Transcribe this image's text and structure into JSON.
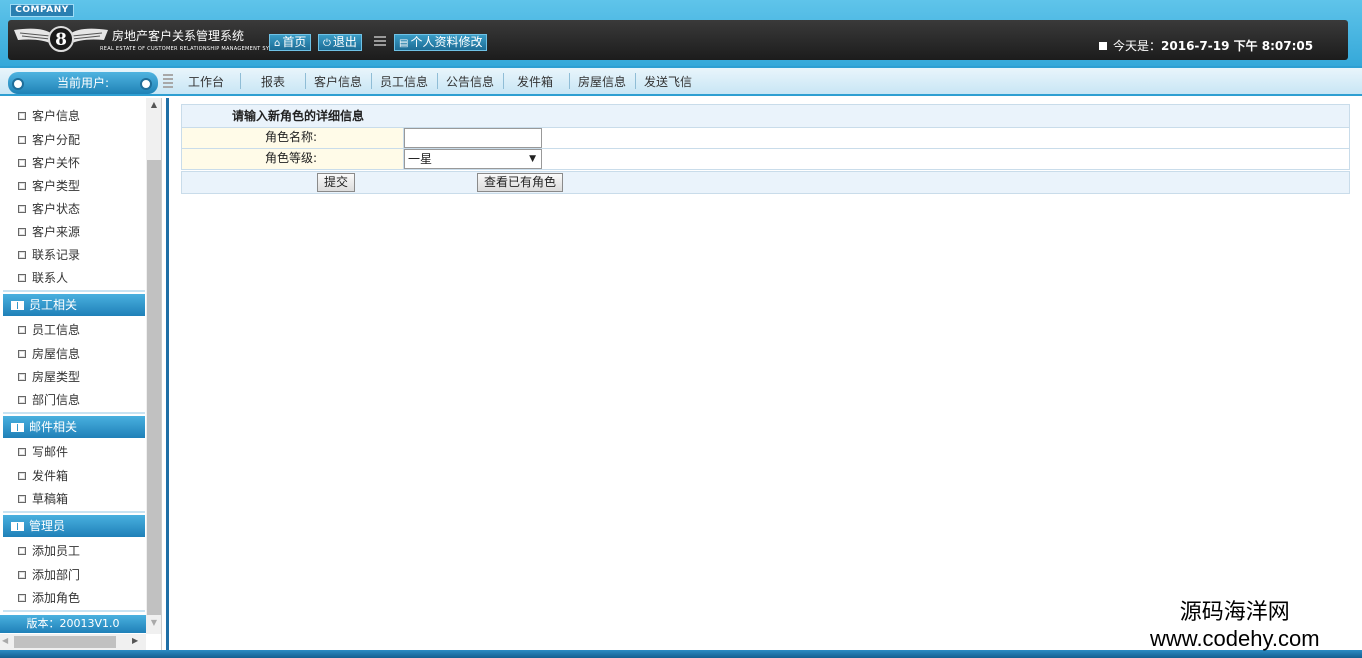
{
  "header": {
    "company_tag": "COMPANY",
    "system_title": "房地产客户关系管理系统",
    "system_subtitle": "REAL ESTATE OF CUSTOMER RELATIONSHIP MANAGEMENT SYSTEM",
    "buttons": {
      "home": "首页",
      "exit": "退出",
      "profile": "个人资料修改"
    },
    "today_label": "今天是：",
    "today_value": "2016-7-19 下午 8:07:05"
  },
  "navbar": {
    "current_user": "当前用户:",
    "items": [
      "工作台",
      "报表",
      "客户信息",
      "员工信息",
      "公告信息",
      "发件箱",
      "房屋信息",
      "发送飞信"
    ]
  },
  "sidebar": {
    "customer_items": [
      "客户信息",
      "客户分配",
      "客户关怀",
      "客户类型",
      "客户状态",
      "客户来源",
      "联系记录",
      "联系人"
    ],
    "employee_section": {
      "title": "员工相关",
      "items": [
        "员工信息",
        "房屋信息",
        "房屋类型",
        "部门信息"
      ]
    },
    "mail_section": {
      "title": "邮件相关",
      "items": [
        "写邮件",
        "发件箱",
        "草稿箱"
      ]
    },
    "admin_section": {
      "title": "管理员",
      "items": [
        "添加员工",
        "添加部门",
        "添加角色"
      ]
    },
    "version": "版本：20013V1.0"
  },
  "form": {
    "title": "请输入新角色的详细信息",
    "role_name_label": "角色名称:",
    "role_name_value": "",
    "role_level_label": "角色等级:",
    "role_level_value": "一星",
    "submit_label": "提交",
    "view_roles_label": "查看已有角色"
  },
  "watermark": {
    "cn": "源码海洋网",
    "en": "www.codehy.com"
  },
  "colors": {
    "accent": "#35a8d9",
    "header_dark": "#1c1c1c",
    "form_label_bg": "#fffbe8",
    "form_title_bg": "#eaf3fb"
  }
}
